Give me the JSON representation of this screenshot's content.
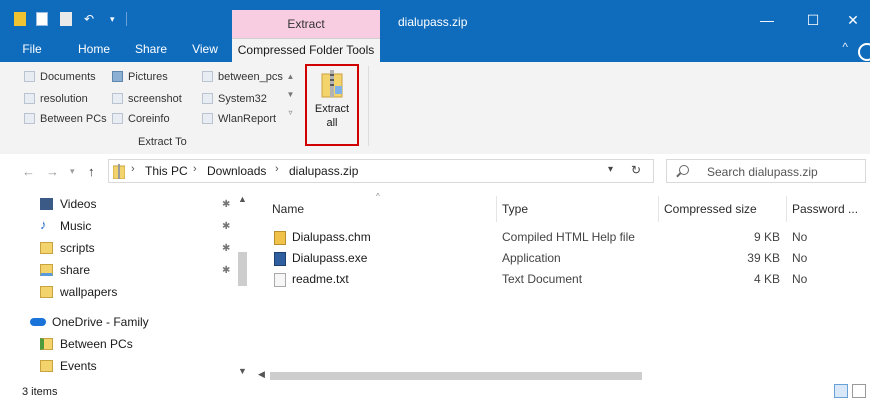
{
  "window": {
    "contextual_tab": "Extract",
    "title": "dialupass.zip",
    "minimize": "—",
    "maximize": "☐",
    "close": "✕"
  },
  "ribbon": {
    "tabs": [
      "File",
      "Home",
      "Share",
      "View",
      "Compressed Folder Tools"
    ],
    "collapse_glyph": "^",
    "locations": [
      {
        "label": "Documents",
        "icon": "documents-icon"
      },
      {
        "label": "Pictures",
        "icon": "pictures-icon"
      },
      {
        "label": "between_pcs",
        "icon": "folder-icon"
      },
      {
        "label": "resolution",
        "icon": "folder-icon"
      },
      {
        "label": "screenshot",
        "icon": "folder-icon"
      },
      {
        "label": "System32",
        "icon": "folder-icon"
      },
      {
        "label": "Between PCs",
        "icon": "folder-icon"
      },
      {
        "label": "Coreinfo",
        "icon": "folder-icon"
      },
      {
        "label": "WlanReport",
        "icon": "folder-icon"
      }
    ],
    "extract_all_label": "Extract all",
    "group_label": "Extract To"
  },
  "address": {
    "crumbs": [
      "This PC",
      "Downloads",
      "dialupass.zip"
    ],
    "search_placeholder": "Search dialupass.zip"
  },
  "nav_pane": {
    "items": [
      {
        "label": "Videos",
        "icon": "videos-icon",
        "pinned": true
      },
      {
        "label": "Music",
        "icon": "music-icon",
        "pinned": true
      },
      {
        "label": "scripts",
        "icon": "folder-icon",
        "pinned": true
      },
      {
        "label": "share",
        "icon": "share-folder-icon",
        "pinned": true
      },
      {
        "label": "wallpapers",
        "icon": "folder-icon",
        "pinned": false
      },
      {
        "label": "OneDrive - Family",
        "icon": "onedrive-icon",
        "pinned": false
      },
      {
        "label": "Between PCs",
        "icon": "shared-folder-icon",
        "pinned": false
      },
      {
        "label": "Events",
        "icon": "folder-icon",
        "pinned": false
      }
    ]
  },
  "file_list": {
    "columns": [
      "Name",
      "Type",
      "Compressed size",
      "Password ..."
    ],
    "rows": [
      {
        "name": "Dialupass.chm",
        "type": "Compiled HTML Help file",
        "size": "9 KB",
        "password": "No",
        "icon": "chm-file-icon"
      },
      {
        "name": "Dialupass.exe",
        "type": "Application",
        "size": "39 KB",
        "password": "No",
        "icon": "exe-file-icon"
      },
      {
        "name": "readme.txt",
        "type": "Text Document",
        "size": "4 KB",
        "password": "No",
        "icon": "txt-file-icon"
      }
    ]
  },
  "status": {
    "item_count": "3 items"
  },
  "colors": {
    "titlebar": "#0f6cbd",
    "contextual_tab": "#f9cde1",
    "highlight_border": "#d00000"
  }
}
